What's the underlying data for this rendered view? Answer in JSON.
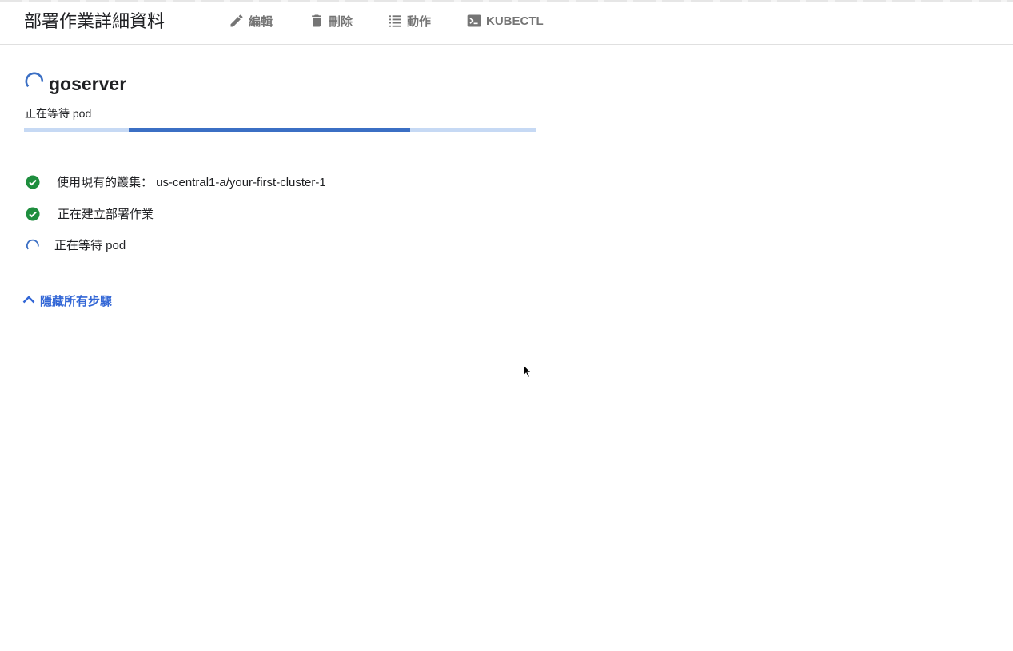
{
  "header": {
    "title": "部署作業詳細資料",
    "actions": [
      {
        "label": "編輯",
        "icon": "pencil-icon"
      },
      {
        "label": "刪除",
        "icon": "trash-icon"
      },
      {
        "label": "動作",
        "icon": "list-icon"
      },
      {
        "label": "KUBECTL",
        "icon": "terminal-icon"
      }
    ]
  },
  "deployment": {
    "name": "goserver",
    "status": "正在等待 pod",
    "progress": {
      "state": "indeterminate"
    }
  },
  "steps": [
    {
      "label": "使用現有的叢集： us-central1-a/your-first-cluster-1",
      "state": "done"
    },
    {
      "label": "正在建立部署作業",
      "state": "done"
    },
    {
      "label": "正在等待 pod",
      "state": "in-progress"
    }
  ],
  "toggle": {
    "label": "隱藏所有步驟",
    "icon": "chevron-up-icon"
  },
  "colors": {
    "accent": "#3367d6",
    "progress_fill": "#3b6fc4",
    "progress_track": "#c6d9f4",
    "success": "#1e8e3e",
    "toolbar_text": "#757575"
  }
}
